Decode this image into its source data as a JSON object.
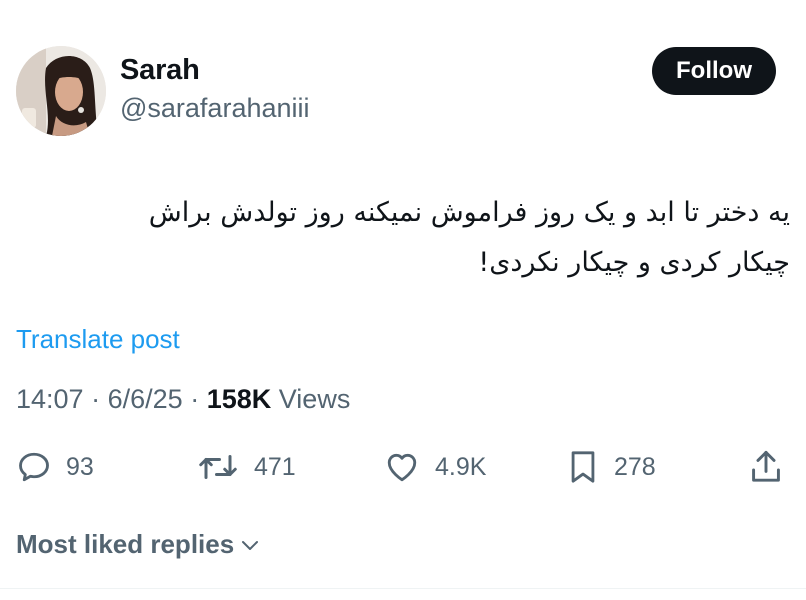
{
  "author": {
    "display_name": "Sarah",
    "handle": "@sarafarahaniii"
  },
  "follow_button": {
    "label": "Follow"
  },
  "tweet": {
    "text_lines": [
      "یه دختر تا ابد و یک روز فراموش نمیکنه روز تولدش براش",
      "چیکار کردی و چیکار نکردی!"
    ],
    "translate_label": "Translate post",
    "time": "14:07",
    "separator": "·",
    "date": "6/6/25",
    "views_count": "158K",
    "views_label": "Views"
  },
  "actions": {
    "replies": {
      "icon": "reply-icon",
      "count": "93"
    },
    "reposts": {
      "icon": "repost-icon",
      "count": "471"
    },
    "likes": {
      "icon": "heart-icon",
      "count": "4.9K"
    },
    "bookmarks": {
      "icon": "bookmark-icon",
      "count": "278"
    },
    "share": {
      "icon": "share-icon"
    }
  },
  "replies_sort": {
    "label": "Most liked replies",
    "icon": "chevron-down-icon"
  },
  "colors": {
    "text": "#0f1419",
    "secondary": "#536471",
    "link": "#1d9bf0",
    "button": "#0f1419"
  }
}
